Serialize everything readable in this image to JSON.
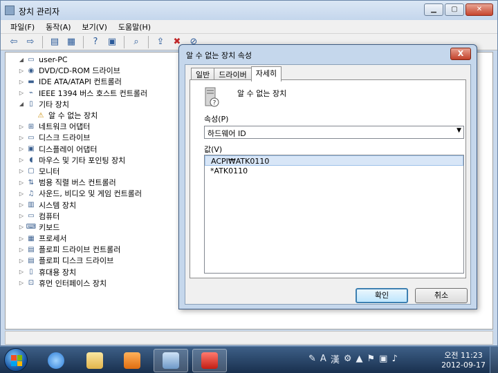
{
  "window": {
    "title": "장치 관리자"
  },
  "menu": [
    {
      "label": "파일(F)"
    },
    {
      "label": "동작(A)"
    },
    {
      "label": "보기(V)"
    },
    {
      "label": "도움말(H)"
    }
  ],
  "tree": {
    "root": "user-PC",
    "items": [
      {
        "label": "DVD/CD-ROM 드라이브",
        "icon": "disc-drive-icon"
      },
      {
        "label": "IDE ATA/ATAPI 컨트롤러",
        "icon": "ide-controller-icon"
      },
      {
        "label": "IEEE 1394 버스 호스트 컨트롤러",
        "icon": "firewire-icon"
      },
      {
        "label": "기타 장치",
        "icon": "other-devices-icon",
        "expanded": true
      },
      {
        "label": "알 수 없는 장치",
        "icon": "warning-device-icon",
        "child": true
      },
      {
        "label": "네트워크 어댑터",
        "icon": "network-adapter-icon"
      },
      {
        "label": "디스크 드라이브",
        "icon": "disk-drive-icon"
      },
      {
        "label": "디스플레이 어댑터",
        "icon": "display-adapter-icon"
      },
      {
        "label": "마우스 및 기타 포인팅 장치",
        "icon": "mouse-icon"
      },
      {
        "label": "모니터",
        "icon": "monitor-icon"
      },
      {
        "label": "범용 직렬 버스 컨트롤러",
        "icon": "usb-icon"
      },
      {
        "label": "사운드, 비디오 및 게임 컨트롤러",
        "icon": "sound-icon"
      },
      {
        "label": "시스템 장치",
        "icon": "system-device-icon"
      },
      {
        "label": "컴퓨터",
        "icon": "computer-icon"
      },
      {
        "label": "키보드",
        "icon": "keyboard-icon"
      },
      {
        "label": "프로세서",
        "icon": "processor-icon"
      },
      {
        "label": "플로피 드라이브 컨트롤러",
        "icon": "floppy-controller-icon"
      },
      {
        "label": "플로피 디스크 드라이브",
        "icon": "floppy-drive-icon"
      },
      {
        "label": "휴대용 장치",
        "icon": "portable-device-icon"
      },
      {
        "label": "휴먼 인터페이스 장치",
        "icon": "hid-icon"
      }
    ]
  },
  "dialog": {
    "title": "알 수 없는 장치 속성",
    "close": "X",
    "tabs": [
      {
        "label": "일반"
      },
      {
        "label": "드라이버"
      },
      {
        "label": "자세히",
        "active": true
      }
    ],
    "device_name": "알 수 없는 장치",
    "property_label": "속성(P)",
    "property_value": "하드웨어 ID",
    "value_label": "값(V)",
    "values": [
      "ACPI₩ATK0110",
      "*ATK0110"
    ],
    "ok": "확인",
    "cancel": "취소"
  },
  "taskbar": {
    "time": "오전 11:23",
    "date": "2012-09-17",
    "ime": "A",
    "ime_hanja": "漢"
  },
  "colors": {
    "accent": "#3c7fb1",
    "close": "#c7452d",
    "taskbar": "#19304e"
  }
}
